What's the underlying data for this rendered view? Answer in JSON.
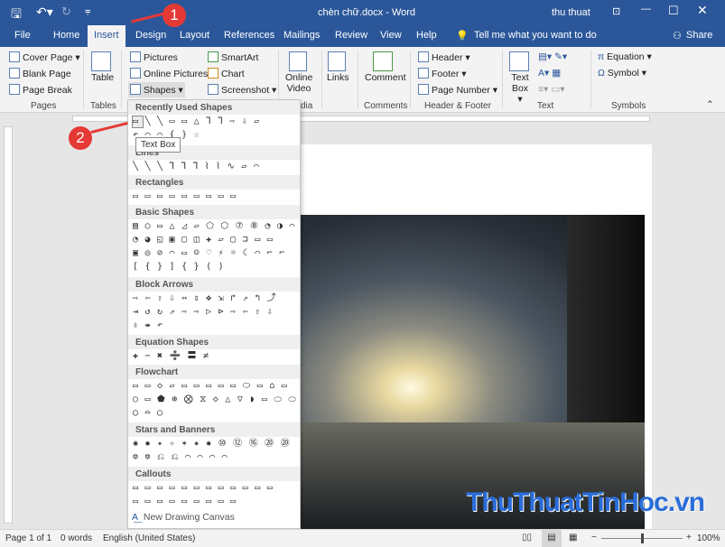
{
  "title": "chèn chữ.docx  -  Word",
  "user": "thu thuat",
  "tabs": [
    "File",
    "Home",
    "Insert",
    "Design",
    "Layout",
    "References",
    "Mailings",
    "Review",
    "View",
    "Help"
  ],
  "tell_me": "Tell me what you want to do",
  "share": "Share",
  "ribbon": {
    "cover_page": "Cover Page ▾",
    "blank_page": "Blank Page",
    "page_break": "Page Break",
    "pages": "Pages",
    "table": "Table",
    "tables": "Tables",
    "pictures": "Pictures",
    "online_pictures": "Online Pictures",
    "shapes": "Shapes ▾",
    "smartart": "SmartArt",
    "chart": "Chart",
    "screenshot": "Screenshot ▾",
    "online_video": "Online Video",
    "media": "dia",
    "links": "Links",
    "comment": "Comment",
    "comments": "Comments",
    "header": "Header ▾",
    "footer": "Footer ▾",
    "page_number": "Page Number ▾",
    "header_footer": "Header & Footer",
    "text_box": "Text Box ▾",
    "text": "Text",
    "equation": "Equation",
    "symbol": "Symbol ▾",
    "symbols": "Symbols"
  },
  "menu": {
    "sections": [
      {
        "title": "Recently Used Shapes",
        "rows": [
          "▭╲╲▭▭△⅂⅂⇨⇩▱",
          "↶⌒⌒{}☆"
        ]
      },
      {
        "title": "Lines",
        "rows": [
          "╲╲╲⅂⅂⅂⌇⌇∿▱⌒"
        ]
      },
      {
        "title": "Rectangles",
        "rows": [
          "▭▭▭▭▭▭▭▭▭"
        ]
      },
      {
        "title": "Basic Shapes",
        "rows": [
          "▤○▭△◿▱⬠⬡⑦⑧◔◑⌒",
          "◔◕◱▣▢◫✚▱▢⊐▭▭",
          "▣◎⊘⌒▭☺♡⚡☼☾⌒⌐⌐",
          "[{}]{}()"
        ]
      },
      {
        "title": "Block Arrows",
        "rows": [
          "⇨⇦⇧⇩⇔⇕✥⇲↱⇗↰⤴",
          "⇥↺↻⇗⇨⇨▷⊳⇨⇦⇧⇩",
          "⇳⇼↶"
        ]
      },
      {
        "title": "Equation Shapes",
        "rows": [
          "✚−✖➗〓≠"
        ]
      },
      {
        "title": "Flowchart",
        "rows": [
          "▭▭◇▱▭▭▭▭▭⬭▭⌂▭",
          "○▭⬟⊕⨂⧖◇△▽◗▭⬭⬭",
          "◯⌓◯"
        ]
      },
      {
        "title": "Stars and Banners",
        "rows": [
          "✺✹✦✧✶✷✸⑩⑫⑯⑳⑳",
          "⎊⎊⎌⎌⌒⌒⌒⌒"
        ]
      },
      {
        "title": "Callouts",
        "rows": [
          "▭▭▭▭▭▭▭▭▭▭▭▭",
          "▭▭▭▭▭▭▭▭▭"
        ]
      }
    ],
    "new_canvas": "New Drawing Canvas"
  },
  "tooltip": "Text Box",
  "badges": [
    "1",
    "2"
  ],
  "watermark": "ThuThuatTinHoc.vn",
  "status": {
    "page": "Page 1 of 1",
    "words": "0 words",
    "language": "English (United States)",
    "zoom": "100%",
    "zoom_level": 100
  }
}
